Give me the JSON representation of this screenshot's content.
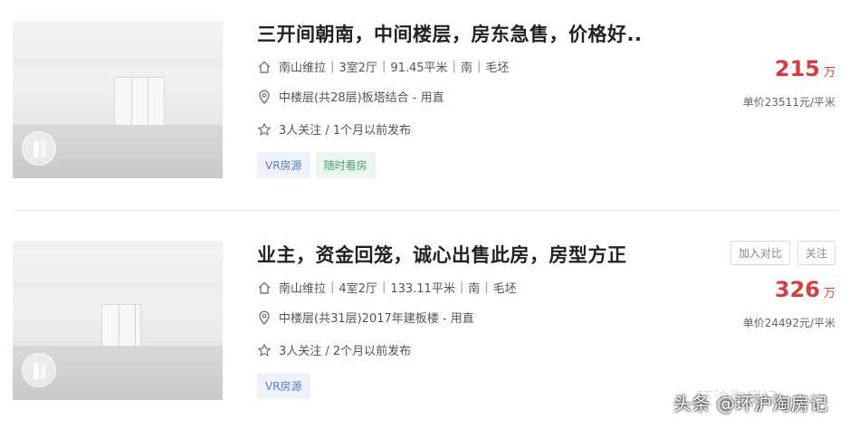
{
  "listings": [
    {
      "title": "三开间朝南，中间楼层，房东急售，价格好..",
      "info": [
        "南山维拉",
        "3室2厅",
        "91.45平米",
        "南",
        "毛坯"
      ],
      "location": "中楼层(共28层)板塔结合 - 用直",
      "follow": "3人关注 / 1个月以前发布",
      "tags": [
        "VR房源",
        "随时看房"
      ],
      "price": "215",
      "price_unit": "万",
      "unit_price": "单价23511元/平米",
      "actions": []
    },
    {
      "title": "业主，资金回笼，诚心出售此房，房型方正",
      "info": [
        "南山维拉",
        "4室2厅",
        "133.11平米",
        "南",
        "毛坯"
      ],
      "location": "中楼层(共31层)2017年建板楼 - 用直",
      "follow": "3人关注 / 2个月以前发布",
      "tags": [
        "VR房源"
      ],
      "price": "326",
      "price_unit": "万",
      "unit_price": "单价24492元/平米",
      "actions": [
        "加入对比",
        "关注"
      ]
    }
  ],
  "watermark": "头条 @环沪淘房记",
  "watermark_faded": "环沪淘房记",
  "colors": {
    "price": "#d33f3f",
    "tag_vr_bg": "#eef2fb",
    "tag_anytime_bg": "#eaf6ee"
  },
  "icons": {
    "info": "house-icon",
    "location": "location-pin-icon",
    "follow": "star-icon",
    "vr": "vr-logo-icon"
  }
}
